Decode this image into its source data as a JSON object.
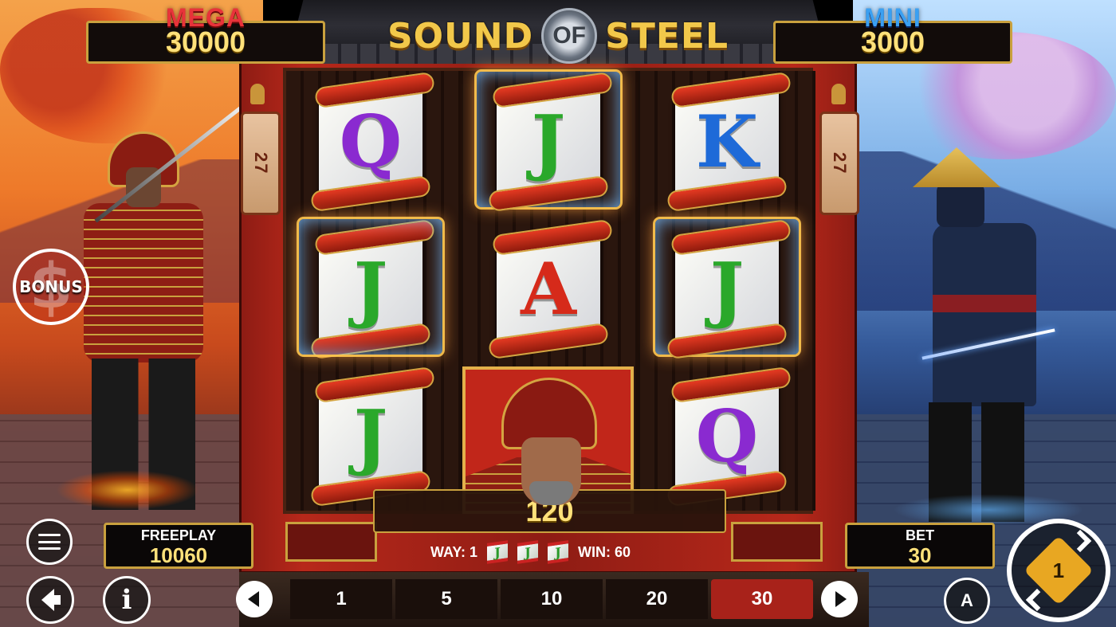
{
  "jackpots": {
    "mega": {
      "label": "MEGA",
      "value": "30000"
    },
    "mini": {
      "label": "MINI",
      "value": "3000"
    }
  },
  "logo": {
    "word1": "SOUND",
    "word2": "OF",
    "word3": "STEEL"
  },
  "side_counters": {
    "left": "27",
    "right": "27"
  },
  "reels": [
    [
      {
        "type": "scroll",
        "letter": "Q",
        "color": "#8a2ad0",
        "highlight": false
      },
      {
        "type": "scroll",
        "letter": "J",
        "color": "#2aa82a",
        "highlight": true
      },
      {
        "type": "scroll",
        "letter": "J",
        "color": "#2aa82a",
        "highlight": false
      }
    ],
    [
      {
        "type": "scroll",
        "letter": "J",
        "color": "#2aa82a",
        "highlight": true
      },
      {
        "type": "scroll",
        "letter": "A",
        "color": "#d62a1a",
        "highlight": false
      },
      {
        "type": "samurai-warrior",
        "highlight": false
      }
    ],
    [
      {
        "type": "scroll",
        "letter": "K",
        "color": "#1e6ad8",
        "highlight": false
      },
      {
        "type": "scroll",
        "letter": "J",
        "color": "#2aa82a",
        "highlight": true
      },
      {
        "type": "scroll",
        "letter": "Q",
        "color": "#8a2ad0",
        "highlight": false
      }
    ]
  ],
  "win": {
    "total": "120",
    "way_label": "WAY: 1",
    "way_symbols": [
      "J",
      "J",
      "J"
    ],
    "line_win_label": "WIN: 60"
  },
  "freeplay": {
    "label": "FREEPLAY",
    "value": "10060"
  },
  "bet": {
    "label": "BET",
    "value": "30"
  },
  "bet_options": [
    "1",
    "5",
    "10",
    "20",
    "30"
  ],
  "selected_bet": "30",
  "buttons": {
    "bonus_label": "BONUS",
    "info_label": "i",
    "auto_label": "A",
    "spin_label": "1",
    "bonus_symbol": "$"
  },
  "colors": {
    "gold": "#c9a13e",
    "mega_red": "#e8333a",
    "mini_blue": "#3aa0f2",
    "value_yellow": "#ffe17a",
    "selected_bet_red": "#a8221a"
  },
  "icons": [
    "menu-icon",
    "speaker-icon",
    "info-icon",
    "auto-play-icon",
    "spin-icon",
    "prev-arrow-icon",
    "next-arrow-icon",
    "bonus-dollar-icon"
  ]
}
